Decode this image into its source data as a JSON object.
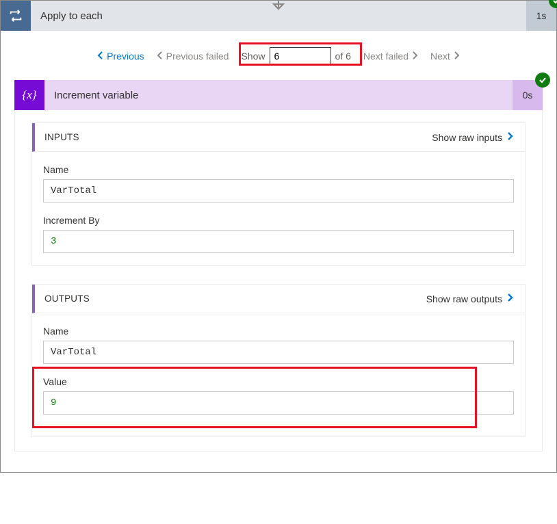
{
  "applyToEach": {
    "title": "Apply to each",
    "duration": "1s"
  },
  "pager": {
    "previous": "Previous",
    "previousFailed": "Previous failed",
    "showLabel": "Show",
    "showValue": "6",
    "ofLabel": "of 6",
    "nextFailed": "Next failed",
    "next": "Next"
  },
  "increment": {
    "title": "Increment variable",
    "duration": "0s",
    "iconGlyph": "{x}"
  },
  "inputs": {
    "heading": "INPUTS",
    "rawLink": "Show raw inputs",
    "nameLabel": "Name",
    "nameValue": "VarTotal",
    "incrementByLabel": "Increment By",
    "incrementByValue": "3"
  },
  "outputs": {
    "heading": "OUTPUTS",
    "rawLink": "Show raw outputs",
    "nameLabel": "Name",
    "nameValue": "VarTotal",
    "valueLabel": "Value",
    "valueValue": "9"
  }
}
